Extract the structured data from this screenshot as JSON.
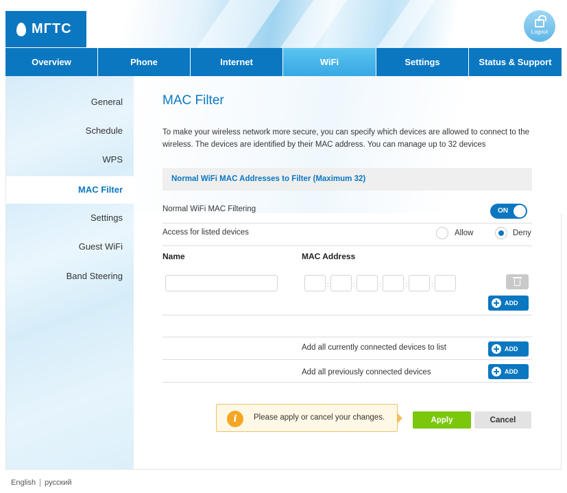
{
  "brand": {
    "logo_text": "МГТС",
    "primary_color": "#0a77c0",
    "active_tab_color": "#36a8e4",
    "apply_color": "#7ac70c"
  },
  "header": {
    "logout_label": "Logout"
  },
  "nav": {
    "tabs": [
      {
        "label": "Overview",
        "active": false
      },
      {
        "label": "Phone",
        "active": false
      },
      {
        "label": "Internet",
        "active": false
      },
      {
        "label": "WiFi",
        "active": true
      },
      {
        "label": "Settings",
        "active": false
      },
      {
        "label": "Status & Support",
        "active": false
      }
    ]
  },
  "sidebar": {
    "items": [
      {
        "label": "General",
        "active": false
      },
      {
        "label": "Schedule",
        "active": false
      },
      {
        "label": "WPS",
        "active": false
      },
      {
        "label": "MAC Filter",
        "active": true
      },
      {
        "label": "Settings",
        "active": false
      },
      {
        "label": "Guest WiFi",
        "active": false
      },
      {
        "label": "Band Steering",
        "active": false
      }
    ]
  },
  "main": {
    "title": "MAC Filter",
    "description": "To make your wireless network more secure, you can specify which devices are allowed to connect to the wireless. The devices are identified by their MAC address. You can manage up to 32 devices",
    "section_title": "Normal WiFi MAC Addresses to Filter (Maximum 32)",
    "filtering_label": "Normal WiFi MAC Filtering",
    "filtering_toggle": "ON",
    "access_label": "Access for listed devices",
    "access_options": [
      "Allow",
      "Deny"
    ],
    "access_selected": "Deny",
    "columns": {
      "name": "Name",
      "mac": "MAC Address"
    },
    "entry": {
      "name": "",
      "mac": [
        "",
        "",
        "",
        "",
        "",
        ""
      ],
      "mac_separator": ":"
    },
    "add_label": "ADD",
    "add_connected_label": "Add all currently connected devices to list",
    "add_previous_label": "Add all previously connected devices"
  },
  "notice": {
    "text": "Please apply or cancel your changes.",
    "icon": "info-icon"
  },
  "actions": {
    "apply": "Apply",
    "cancel": "Cancel"
  },
  "footer": {
    "languages": [
      "English",
      "русский"
    ]
  }
}
